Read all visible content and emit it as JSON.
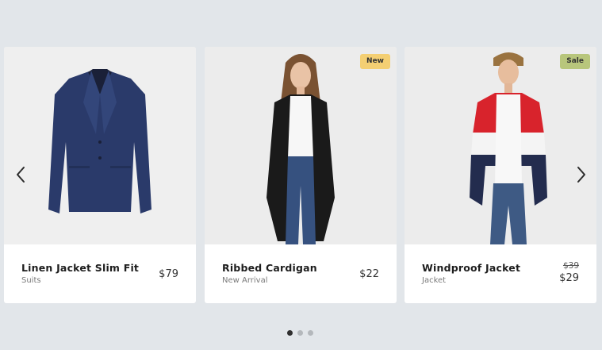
{
  "products": [
    {
      "name": "Linen Jacket Slim Fit",
      "category": "Suits",
      "price": "$79",
      "badge": "",
      "image": "navy-blazer"
    },
    {
      "name": "Ribbed Cardigan",
      "category": "New Arrival",
      "price": "$22",
      "badge": "New",
      "image": "woman-black-cardigan"
    },
    {
      "name": "Windproof Jacket",
      "category": "Jacket",
      "old_price": "$39",
      "price": "$29",
      "badge": "Sale",
      "image": "man-red-white-jacket"
    }
  ],
  "pagination": {
    "total": 3,
    "active_index": 0
  },
  "icons": {
    "prev": "chevron-left-icon",
    "next": "chevron-right-icon"
  },
  "colors": {
    "new_badge": "#f4cf73",
    "sale_badge": "#b8c67c",
    "active_dot": "#2f2f2f",
    "inactive_dot": "#b4b8bc"
  }
}
